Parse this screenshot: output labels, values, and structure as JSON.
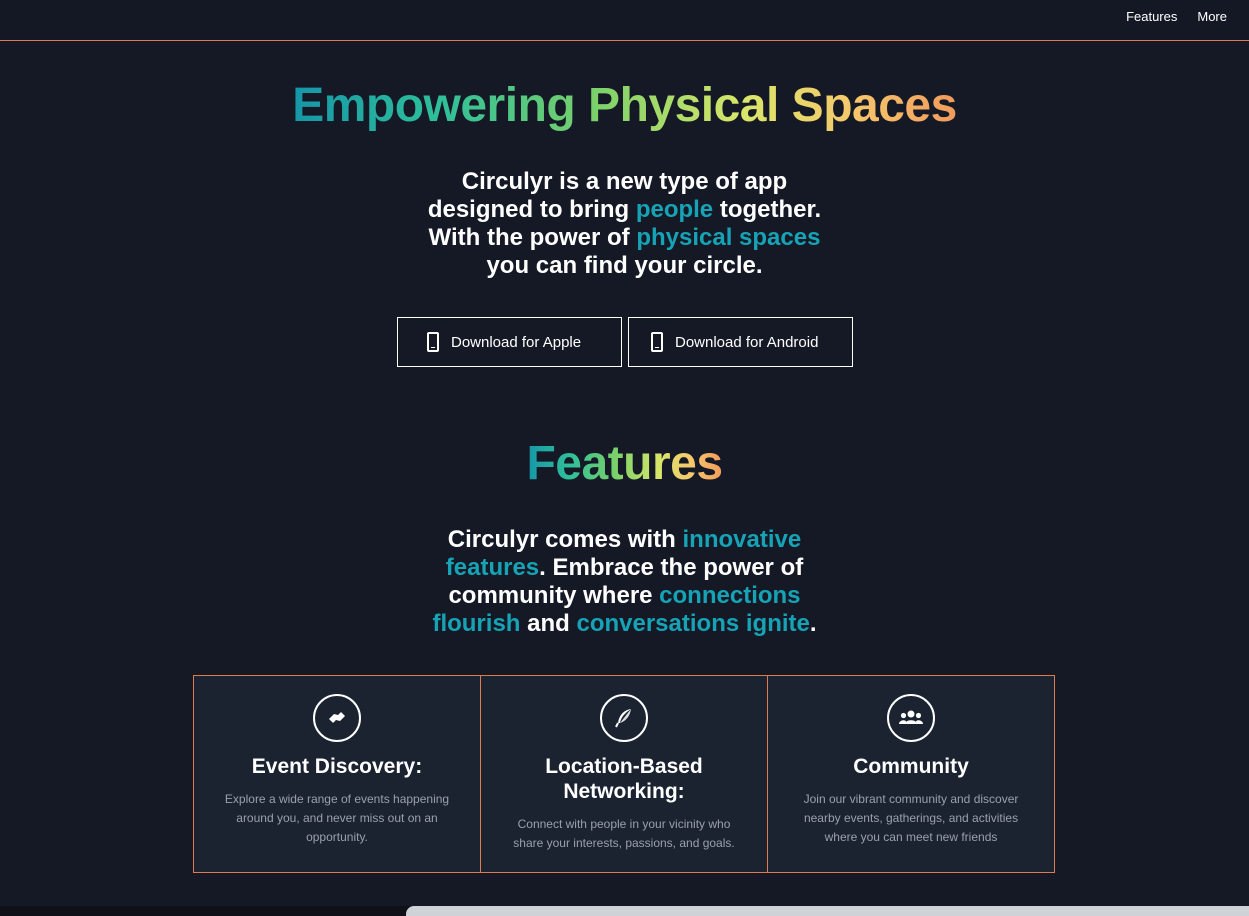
{
  "nav": {
    "items": [
      "Features",
      "More"
    ]
  },
  "hero": {
    "title": "Empowering Physical Spaces",
    "lines": [
      [
        {
          "t": "Circulyr is a new type of app",
          "h": false
        }
      ],
      [
        {
          "t": "designed to bring ",
          "h": false
        },
        {
          "t": "people",
          "h": true
        },
        {
          "t": " together.",
          "h": false
        }
      ],
      [
        {
          "t": "With the power of ",
          "h": false
        },
        {
          "t": "physical spaces",
          "h": true
        }
      ],
      [
        {
          "t": "you can find your circle.",
          "h": false
        }
      ]
    ],
    "buttons": {
      "apple": "Download for Apple",
      "android": "Download for Android"
    }
  },
  "features": {
    "title": "Features",
    "lines": [
      [
        {
          "t": "Circulyr comes with ",
          "h": false
        },
        {
          "t": "innovative",
          "h": true
        }
      ],
      [
        {
          "t": "features",
          "h": true
        },
        {
          "t": ". Embrace the power of",
          "h": false
        }
      ],
      [
        {
          "t": "community where ",
          "h": false
        },
        {
          "t": "connections",
          "h": true
        }
      ],
      [
        {
          "t": "flourish",
          "h": true
        },
        {
          "t": " and ",
          "h": false
        },
        {
          "t": "conversations ignite",
          "h": true
        },
        {
          "t": ".",
          "h": false
        }
      ]
    ],
    "cards": [
      {
        "icon": "handshake-icon",
        "title": "Event Discovery:",
        "desc": "Explore a wide range of events happening around you, and never miss out on an opportunity."
      },
      {
        "icon": "feather-icon",
        "title": "Location-Based Networking:",
        "desc": "Connect with people in your vicinity who share your interests, passions, and goals."
      },
      {
        "icon": "users-icon",
        "title": "Community",
        "desc": "Join our vibrant community and discover nearby events, gatherings, and activities where you can meet new friends"
      }
    ]
  },
  "colors": {
    "background": "#141925",
    "accent": "#17a3b6",
    "border": "#e07a4f"
  }
}
